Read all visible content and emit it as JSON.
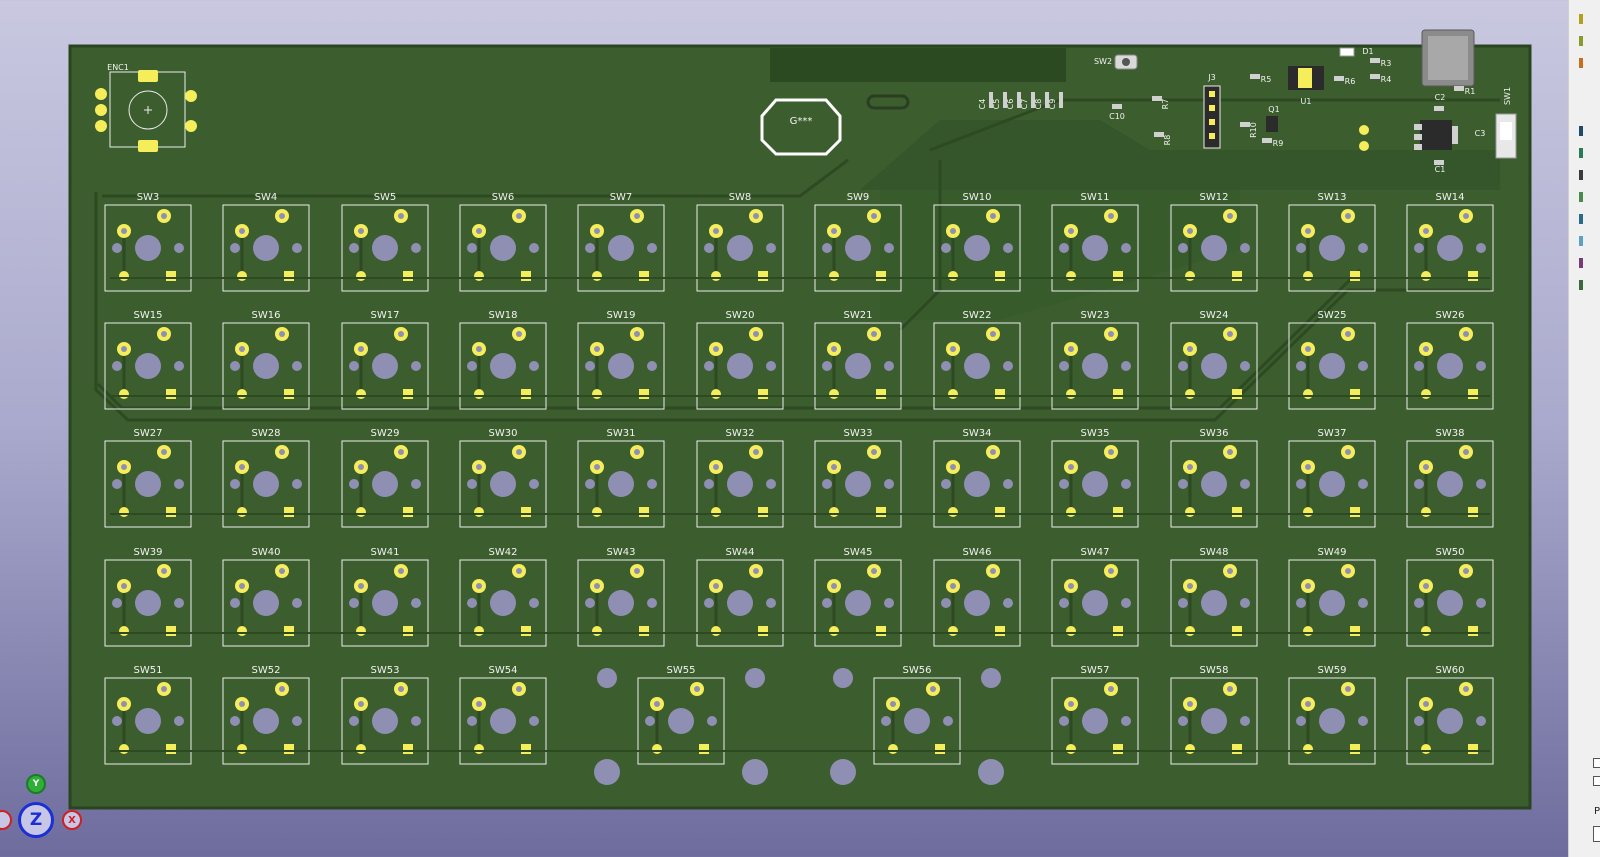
{
  "viewer": {
    "axis_labels": {
      "z": "Z",
      "y": "Y",
      "x": "X"
    }
  },
  "colors": {
    "board": "#3c5e2e",
    "board_edge": "#2a4420",
    "pad": "#f5ee5a",
    "hole": "#8f8fb4",
    "silk": "#ececec",
    "trace": "#2d4a22"
  },
  "components": {
    "enc1": "ENC1",
    "sw1": "SW1",
    "sw2": "SW2",
    "j3": "J3",
    "u1": "U1",
    "q1": "Q1",
    "d1": "D1",
    "logo": "G***",
    "caps_top": [
      "C4",
      "C5",
      "C6",
      "C7",
      "C8",
      "C9"
    ],
    "c10": "C10",
    "c1": "C1",
    "c2": "C2",
    "c3": "C3",
    "resistors": [
      "R1",
      "R3",
      "R4",
      "R5",
      "R6",
      "R7",
      "R8",
      "R9",
      "R10"
    ]
  },
  "switch_rows": [
    [
      "SW3",
      "SW4",
      "SW5",
      "SW6",
      "SW7",
      "SW8",
      "SW9",
      "SW10",
      "SW11",
      "SW12",
      "SW13",
      "SW14"
    ],
    [
      "SW15",
      "SW16",
      "SW17",
      "SW18",
      "SW19",
      "SW20",
      "SW21",
      "SW22",
      "SW23",
      "SW24",
      "SW25",
      "SW26"
    ],
    [
      "SW27",
      "SW28",
      "SW29",
      "SW30",
      "SW31",
      "SW32",
      "SW33",
      "SW34",
      "SW35",
      "SW36",
      "SW37",
      "SW38"
    ],
    [
      "SW39",
      "SW40",
      "SW41",
      "SW42",
      "SW43",
      "SW44",
      "SW45",
      "SW46",
      "SW47",
      "SW48",
      "SW49",
      "SW50"
    ],
    [
      "SW51",
      "SW52",
      "SW53",
      "SW54",
      "SW55",
      "SW56",
      "SW57",
      "SW58",
      "SW59",
      "SW60"
    ]
  ],
  "right_panel": {
    "partial_text": "P"
  }
}
